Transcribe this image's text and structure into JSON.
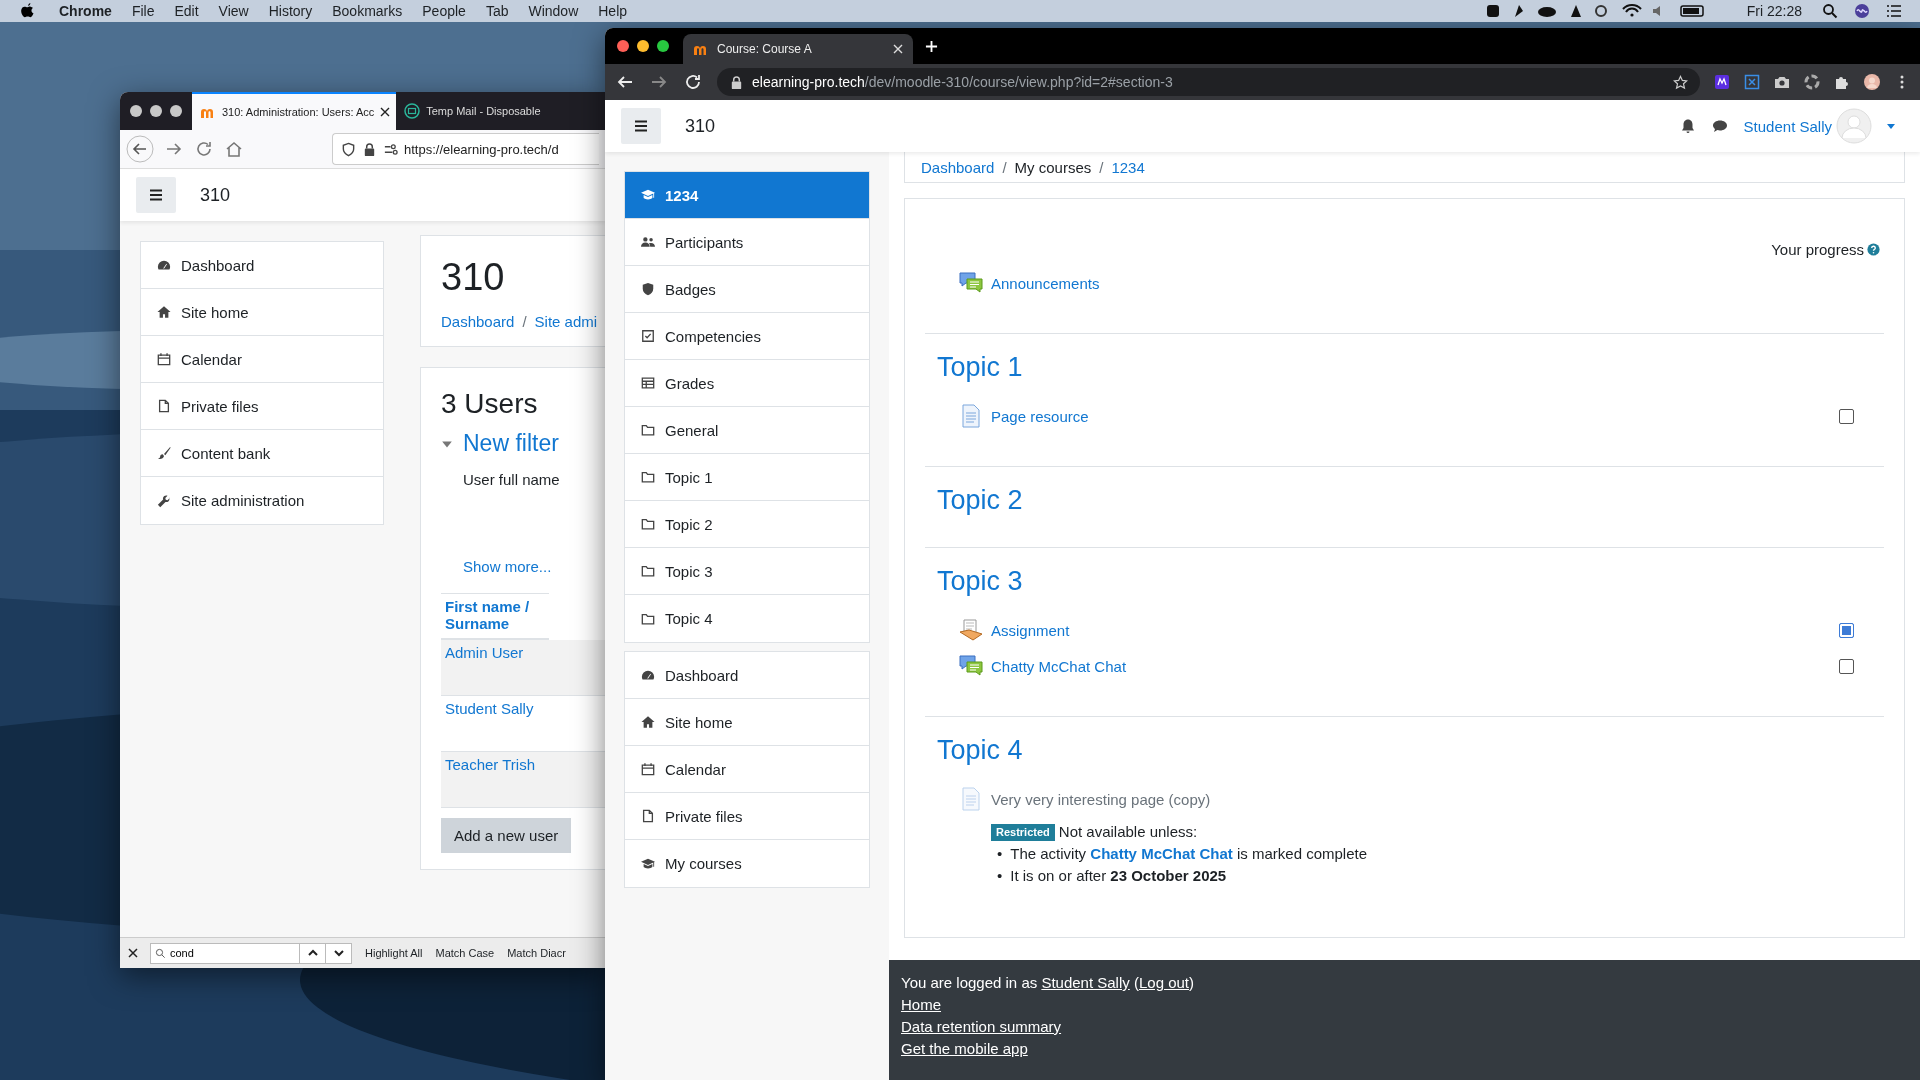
{
  "menu_bar": {
    "app": "Chrome",
    "items": [
      "File",
      "Edit",
      "View",
      "History",
      "Bookmarks",
      "People",
      "Tab",
      "Window",
      "Help"
    ],
    "clock": "Fri 22:28"
  },
  "back_window": {
    "tabs": [
      {
        "title": "310: Administration: Users: Acc",
        "selected": true
      },
      {
        "title": "Temp Mail - Disposable",
        "selected": false
      }
    ],
    "url": "https://elearning-pro.tech/d",
    "site_name": "310",
    "nav": [
      "Dashboard",
      "Site home",
      "Calendar",
      "Private files",
      "Content bank",
      "Site administration"
    ],
    "page_title": "310",
    "breadcrumb": [
      {
        "text": "Dashboard",
        "kind": "link"
      },
      {
        "text": "/",
        "kind": "separator"
      },
      {
        "text": "Site admi",
        "kind": "link"
      }
    ],
    "users_heading": "3 Users",
    "filter": {
      "title": "New filter",
      "expanded": true,
      "field_label": "User full name",
      "show_more": "Show more..."
    },
    "table": {
      "column": "First name / Surname",
      "rows": [
        "Admin User",
        "Student Sally",
        "Teacher Trish"
      ]
    },
    "add_button": "Add a new user",
    "find_bar": {
      "value": "cond",
      "options": [
        "Highlight All",
        "Match Case",
        "Match Diacr"
      ]
    }
  },
  "front_window": {
    "tabs": [
      {
        "title": "Course: Course A",
        "selected": true
      }
    ],
    "url": {
      "host": "elearning-pro.tech",
      "path": "/dev/moodle-310/course/view.php?id=2#section-3"
    },
    "site_name": "310",
    "user_name": "Student Sally",
    "breadcrumb": [
      {
        "text": "Dashboard",
        "kind": "link"
      },
      {
        "text": "/",
        "kind": "separator"
      },
      {
        "text": "My courses",
        "kind": "text"
      },
      {
        "text": "/",
        "kind": "separator"
      },
      {
        "text": "1234",
        "kind": "link"
      }
    ],
    "nav_groups": [
      [
        {
          "label": "1234",
          "selected": true
        },
        {
          "label": "Participants",
          "selected": false
        },
        {
          "label": "Badges",
          "selected": false
        },
        {
          "label": "Competencies",
          "selected": false
        },
        {
          "label": "Grades",
          "selected": false
        },
        {
          "label": "General",
          "selected": false
        },
        {
          "label": "Topic 1",
          "selected": false
        },
        {
          "label": "Topic 2",
          "selected": false
        },
        {
          "label": "Topic 3",
          "selected": false
        },
        {
          "label": "Topic 4",
          "selected": false
        }
      ],
      [
        {
          "label": "Dashboard",
          "selected": false
        },
        {
          "label": "Site home",
          "selected": false
        },
        {
          "label": "Calendar",
          "selected": false
        },
        {
          "label": "Private files",
          "selected": false
        },
        {
          "label": "My courses",
          "selected": false
        }
      ]
    ],
    "progress_label": "Your progress",
    "sections": [
      {
        "activities": [
          {
            "kind": "forum",
            "name": "Announcements",
            "available": true
          }
        ]
      },
      {
        "title": "Topic 1",
        "activities": [
          {
            "kind": "page",
            "name": "Page resource",
            "available": true,
            "checkbox": {
              "checked": false
            }
          }
        ]
      },
      {
        "title": "Topic 2"
      },
      {
        "title": "Topic 3",
        "activities": [
          {
            "kind": "assignment",
            "name": "Assignment",
            "available": true,
            "checkbox": {
              "checked": true
            }
          },
          {
            "kind": "forum",
            "name": "Chatty McChat Chat",
            "available": true,
            "checkbox": {
              "checked": false
            }
          }
        ]
      },
      {
        "title": "Topic 4",
        "activities": [
          {
            "kind": "page",
            "name": "Very very interesting page (copy)",
            "available": false,
            "restriction": {
              "badge": "Restricted",
              "intro": "Not available unless:",
              "conditions": [
                {
                  "bullet": "•",
                  "before": "The activity ",
                  "link": "Chatty McChat Chat",
                  "after": " is marked complete"
                },
                {
                  "bullet": "•",
                  "before": "It is on or after **23 October 2025**"
                }
              ]
            }
          }
        ]
      }
    ],
    "footer": {
      "prefix": "You are logged in as ",
      "user": "Student Sally",
      "middle": " (",
      "logout": "Log out",
      "suffix": ")",
      "links": [
        "Home",
        "Data retention summary",
        "Get the mobile app"
      ]
    }
  }
}
